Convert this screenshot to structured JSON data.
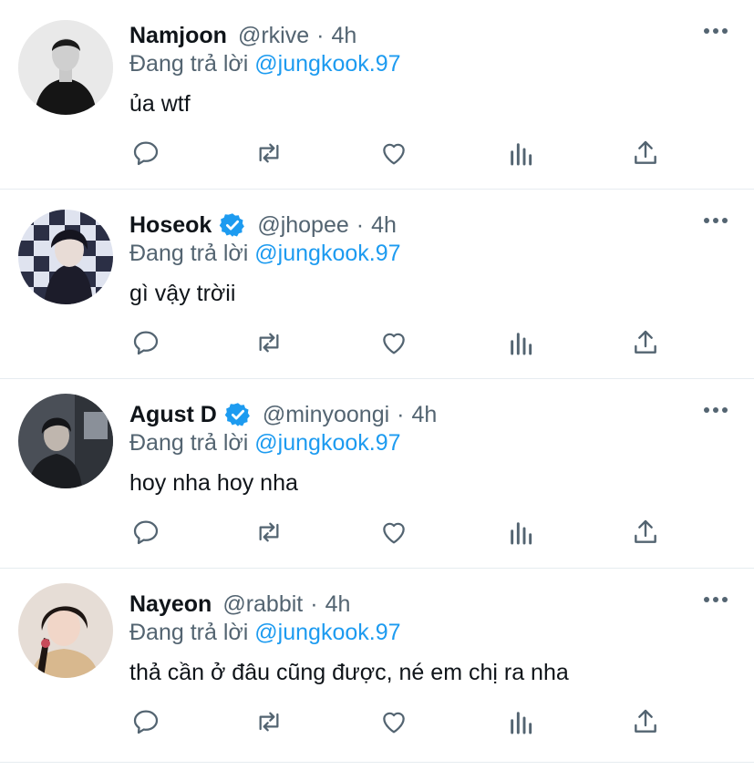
{
  "tweets": [
    {
      "name": "Namjoon",
      "verified": false,
      "handle": "@rkive",
      "time": "4h",
      "reply_prefix": "Đang trả lời",
      "reply_to": "@jungkook.97",
      "text": "ủa wtf",
      "avatar_icon": "avatar-namjoon"
    },
    {
      "name": "Hoseok",
      "verified": true,
      "handle": "@jhopee",
      "time": "4h",
      "reply_prefix": "Đang trả lời",
      "reply_to": "@jungkook.97",
      "text": "gì vậy trờii",
      "avatar_icon": "avatar-hoseok"
    },
    {
      "name": "Agust D",
      "verified": true,
      "handle": "@minyoongi",
      "time": "4h",
      "reply_prefix": "Đang trả lời",
      "reply_to": "@jungkook.97",
      "text": "hoy nha hoy nha",
      "avatar_icon": "avatar-agustd"
    },
    {
      "name": "Nayeon",
      "verified": false,
      "handle": "@rabbit",
      "time": "4h",
      "reply_prefix": "Đang trả lời",
      "reply_to": "@jungkook.97",
      "text": "thả cần ở đâu cũng được, né em chị ra nha",
      "avatar_icon": "avatar-nayeon"
    }
  ],
  "separator": "·",
  "colors": {
    "accent": "#1d9bf0",
    "muted": "#536471",
    "text": "#0f1419",
    "divider": "#e6ecf0"
  }
}
